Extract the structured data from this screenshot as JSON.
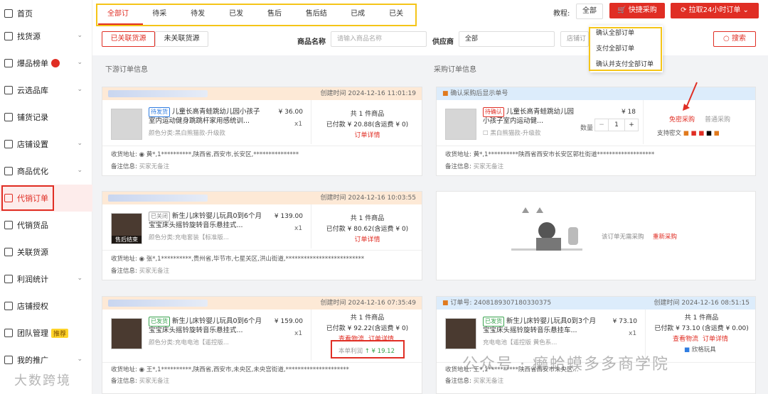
{
  "sidebar": {
    "items": [
      {
        "label": "首页",
        "icon": "home-icon"
      },
      {
        "label": "找货源",
        "icon": "search-goods-icon"
      },
      {
        "label": "爆品榜单",
        "icon": "fire-list-icon"
      },
      {
        "label": "云选品库",
        "icon": "cloud-icon"
      },
      {
        "label": "铺货记录",
        "icon": "record-icon"
      },
      {
        "label": "店铺设置",
        "icon": "store-icon"
      },
      {
        "label": "商品优化",
        "icon": "optimize-icon"
      },
      {
        "label": "代销订单",
        "icon": "order-icon"
      },
      {
        "label": "代销货品",
        "icon": "goods-icon"
      },
      {
        "label": "关联货源",
        "icon": "link-icon"
      },
      {
        "label": "利润统计",
        "icon": "profit-icon"
      },
      {
        "label": "店铺授权",
        "icon": "auth-icon"
      },
      {
        "label": "团队管理",
        "icon": "team-icon"
      },
      {
        "label": "我的推广",
        "icon": "promo-icon"
      }
    ],
    "team_tag": "推荐"
  },
  "tabs": [
    "全部订单",
    "待采购",
    "待发货",
    "已发货",
    "售后中",
    "售后结束",
    "已成功",
    "已关闭"
  ],
  "toolbar": {
    "tutorial": "教程:",
    "all_btn": "全部",
    "quick_buy": "快捷采购",
    "pull_orders": "拉取24小时订单"
  },
  "dropdown": [
    "确认全部订单",
    "支付全部订单",
    "确认并支付全部订单"
  ],
  "filter": {
    "linked": "已关联货源",
    "unlinked": "未关联货源",
    "product_name_label": "商品名称",
    "product_name_placeholder": "请输入商品名称",
    "supplier_label": "供应商",
    "supplier_value": "全部",
    "store_label": "店铺订",
    "search": "搜索"
  },
  "sections": {
    "downstream": "下游订单信息",
    "purchase": "采购订单信息"
  },
  "orders": [
    {
      "time": "创建时间 2024-12-16 11:01:19",
      "status": "待发货",
      "title": "儿童长高青蛙跳幼儿园小孩子室内运动健身跳跳杆家用感统训...",
      "spec": "颜色分类:黑白熊猫款-升级款",
      "price": "¥ 36.00",
      "qty": "x1",
      "count": "共 1 件商品",
      "paid": "已付款 ¥ 20.88(含运费 ¥ 0)",
      "detail": "订单详情",
      "address": "收货地址:",
      "addr_val": "黄*,1**********,陕西省,西安市,长安区,***************",
      "note": "备注信息:",
      "note_val": "买家无备注"
    },
    {
      "time": "创建时间 2024-12-16 10:03:55",
      "status": "已关闭",
      "title": "新生儿床铃婴儿玩具0到6个月宝宝床头摇铃旋转音乐悬挂式...",
      "spec": "颜色分类:充电套装【标准版...",
      "price": "¥ 139.00",
      "qty": "x1",
      "count": "共 1 件商品",
      "paid": "已付款 ¥ 80.62(含运费 ¥ 0)",
      "detail": "订单详情",
      "after_sale": "售后结束",
      "address": "收货地址:",
      "addr_val": "张*,1**********,贵州省,毕节市,七星关区,洪山街道,**************************",
      "note": "备注信息:",
      "note_val": "买家无备注"
    },
    {
      "time": "创建时间 2024-12-16 07:35:49",
      "status": "已发货",
      "title": "新生儿床铃婴儿玩具0到6个月宝宝床头摇铃旋转音乐悬挂式...",
      "spec": "颜色分类:充电电池【遥控版...",
      "price": "¥ 159.00",
      "qty": "x1",
      "count": "共 1 件商品",
      "paid": "已付款 ¥ 92.22(含运费 ¥ 0)",
      "logistics": "查看物流",
      "detail": "订单详情",
      "profit_label": "本单利润",
      "profit_val": "¥ 19.12",
      "address": "收货地址:",
      "addr_val": "王*,1**********,陕西省,西安市,未央区,未央宫街道,*********************",
      "note": "备注信息:",
      "note_val": "买家无备注"
    }
  ],
  "purchase": [
    {
      "head": "确认采购后显示单号",
      "status": "待确认",
      "title": "儿童长高青蛙跳幼儿园小孩子室内运动健...",
      "spec": "黑白熊猫款-升级款",
      "price": "¥ 18",
      "qty_label": "数量",
      "qty": "1",
      "free_buy": "免密采购",
      "normal_buy": "普通采购",
      "pay_support": "支持密文",
      "address": "收货地址:",
      "addr_val": "黄*,1**********陕西省西安市长安区郭杜街道*******************",
      "note": "备注信息:",
      "note_val": "买家无备注"
    },
    {
      "empty_text": "该订单无需采购",
      "repurchase": "重新采购"
    },
    {
      "head": "订单号: 2408189307180330375",
      "time": "创建时间 2024-12-16 08:51:15",
      "status": "已发货",
      "title": "新生儿床铃婴儿玩具0到3个月宝宝床头摇铃旋转音乐悬挂车...",
      "spec": "充电电池【遥控版 黄色系...",
      "price": "¥ 73.10",
      "qty": "x1",
      "count": "共 1 件商品",
      "paid": "已付款 ¥ 73.10 (含运费 ¥ 0.00)",
      "logistics": "查看物流",
      "detail": "订单详情",
      "shop": "欣格玩具",
      "address": "收货地址:",
      "addr_val": "王*,1**********陕西省西安市未央区...",
      "note": "备注信息:",
      "note_val": "买家无备注"
    }
  ],
  "watermarks": [
    "大数跨境",
    "公众号 · 癞蛤蟆多多商学院"
  ],
  "colors": {
    "accent": "#e02e24",
    "highlight": "#f5c518"
  }
}
